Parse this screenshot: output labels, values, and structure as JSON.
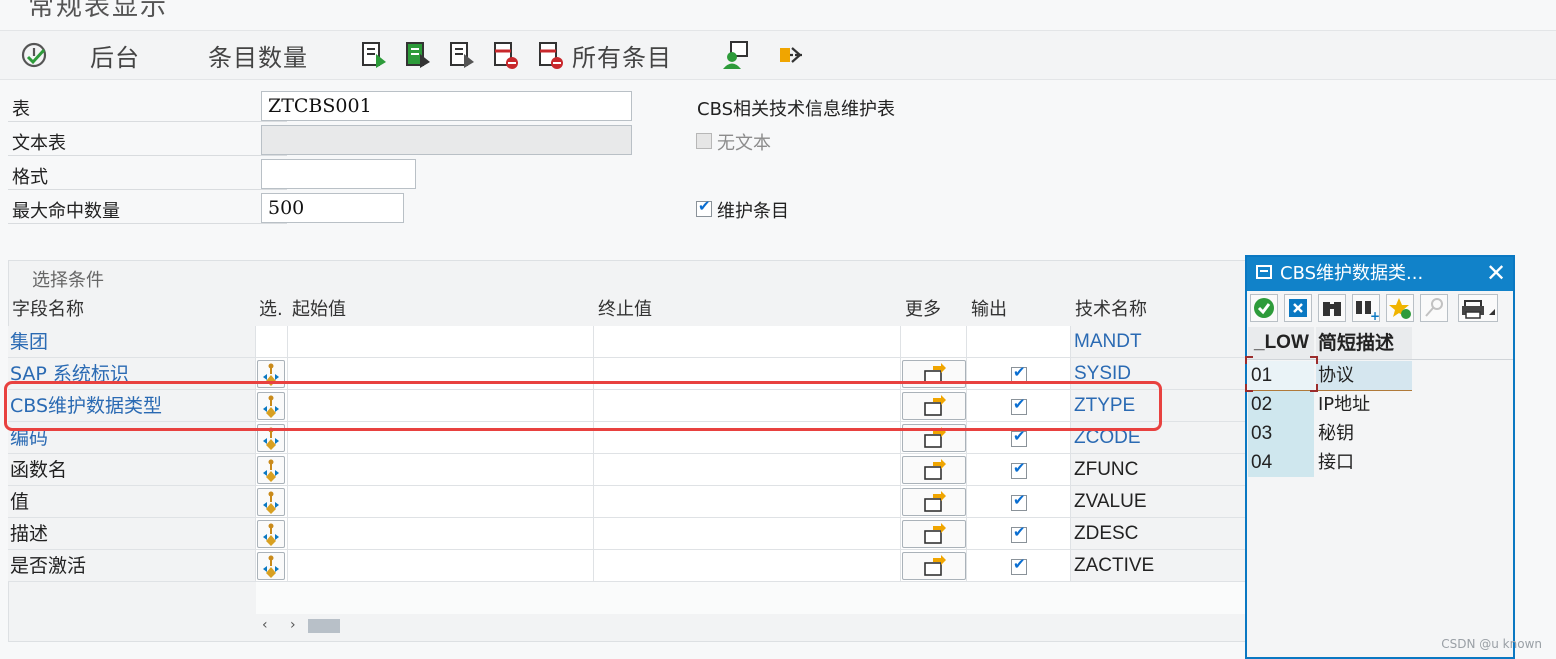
{
  "window": {
    "title": "常规表显示"
  },
  "toolbar": {
    "background_label": "后台",
    "entry_count_label": "条目数量",
    "all_entries_label": "所有条目"
  },
  "form": {
    "table_label": "表",
    "table_value": "ZTCBS001",
    "table_description": "CBS相关技术信息维护表",
    "text_table_label": "文本表",
    "text_table_value": "",
    "no_text_label": "无文本",
    "no_text_checked": false,
    "layout_label": "格式",
    "layout_value": "",
    "max_hits_label": "最大命中数量",
    "max_hits_value": "500",
    "maintain_entries_label": "维护条目",
    "maintain_entries_checked": true
  },
  "selection": {
    "title": "选择条件",
    "columns": {
      "field_name": "字段名称",
      "option": "选.",
      "from": "起始值",
      "to": "终止值",
      "more": "更多",
      "output": "输出",
      "tech_name": "技术名称"
    },
    "rows": [
      {
        "field": "集团",
        "tech": "MANDT",
        "link": true,
        "has_controls": false,
        "output": false
      },
      {
        "field": "SAP 系统标识",
        "tech": "SYSID",
        "link": true,
        "has_controls": true,
        "output": true
      },
      {
        "field": "CBS维护数据类型",
        "tech": "ZTYPE",
        "link": true,
        "has_controls": true,
        "output": true
      },
      {
        "field": "编码",
        "tech": "ZCODE",
        "link": true,
        "has_controls": true,
        "output": true
      },
      {
        "field": "函数名",
        "tech": "ZFUNC",
        "link": false,
        "has_controls": true,
        "output": true
      },
      {
        "field": "值",
        "tech": "ZVALUE",
        "link": false,
        "has_controls": true,
        "output": true
      },
      {
        "field": "描述",
        "tech": "ZDESC",
        "link": false,
        "has_controls": true,
        "output": true
      },
      {
        "field": "是否激活",
        "tech": "ZACTIVE",
        "link": false,
        "has_controls": true,
        "output": true
      }
    ]
  },
  "popup": {
    "title": "CBS维护数据类...",
    "col_low": "_LOW",
    "col_desc": "简短描述",
    "rows": [
      {
        "low": "01",
        "desc": "协议"
      },
      {
        "low": "02",
        "desc": "IP地址"
      },
      {
        "low": "03",
        "desc": "秘钥"
      },
      {
        "low": "04",
        "desc": "接口"
      }
    ]
  },
  "watermark": "CSDN @u known",
  "colors": {
    "accent": "#0a6ed1",
    "highlight": "#e8413f",
    "link": "#2a6ab3",
    "popup_header": "#1182c9"
  }
}
